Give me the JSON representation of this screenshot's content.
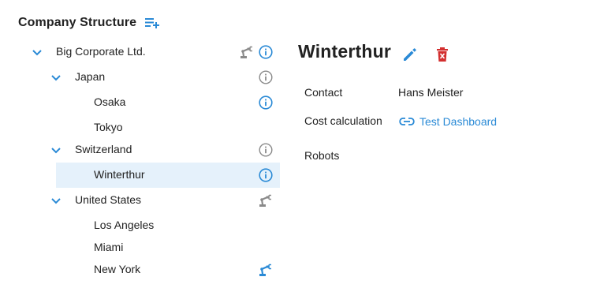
{
  "header": {
    "title": "Company Structure",
    "add_icon": "playlist-add-icon"
  },
  "tree": {
    "nodes": [
      {
        "label": "Big Corporate Ltd.",
        "expanded": true,
        "icons": [
          "robot-arm-icon",
          "info-icon"
        ],
        "info_color": "#2a8ad6"
      },
      {
        "label": "Japan",
        "expanded": true,
        "icons": [
          "info-icon"
        ],
        "info_color": "#8a8a8a"
      },
      {
        "label": "Osaka",
        "icons": [
          "info-icon"
        ],
        "info_color": "#2a8ad6"
      },
      {
        "label": "Tokyo",
        "icons": []
      },
      {
        "label": "Switzerland",
        "expanded": true,
        "icons": [
          "info-icon"
        ],
        "info_color": "#8a8a8a"
      },
      {
        "label": "Winterthur",
        "selected": true,
        "icons": [
          "info-icon"
        ],
        "info_color": "#2a8ad6"
      },
      {
        "label": "United States",
        "expanded": true,
        "icons": [
          "robot-arm-icon"
        ],
        "robot_color": "#8a8a8a"
      },
      {
        "label": "Los Angeles",
        "icons": []
      },
      {
        "label": "Miami",
        "icons": []
      },
      {
        "label": "New York",
        "icons": [
          "robot-arm-icon"
        ],
        "robot_color": "#2a8ad6"
      }
    ]
  },
  "detail": {
    "title": "Winterthur",
    "edit_icon": "pencil-icon",
    "delete_icon": "trash-icon",
    "fields": {
      "contact_label": "Contact",
      "contact_value": "Hans Meister",
      "cost_label": "Cost calculation",
      "cost_link": "Test Dashboard",
      "robots_label": "Robots"
    }
  },
  "colors": {
    "accent": "#2a8ad6",
    "selected_bg": "#e5f1fb",
    "muted_icon": "#8a8a8a",
    "delete": "#d32f2f",
    "text": "#222222"
  }
}
